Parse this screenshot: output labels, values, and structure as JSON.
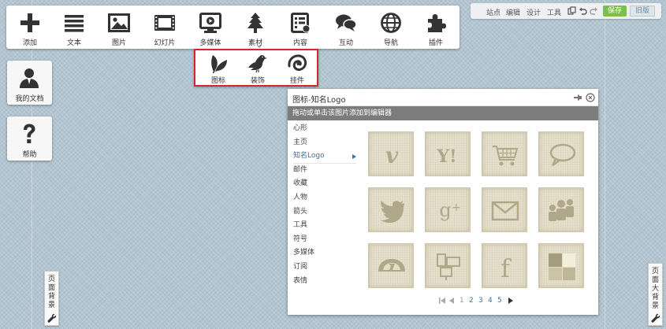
{
  "toolbar": {
    "items": [
      {
        "label": "添加",
        "icon": "plus-icon"
      },
      {
        "label": "文本",
        "icon": "text-lines-icon"
      },
      {
        "label": "图片",
        "icon": "picture-icon"
      },
      {
        "label": "幻灯片",
        "icon": "film-strip-icon"
      },
      {
        "label": "多媒体",
        "icon": "media-player-icon"
      },
      {
        "label": "素材",
        "icon": "tree-icon"
      },
      {
        "label": "内容",
        "icon": "content-list-icon"
      },
      {
        "label": "互动",
        "icon": "chat-bubbles-icon"
      },
      {
        "label": "导航",
        "icon": "globe-icon"
      },
      {
        "label": "插件",
        "icon": "puzzle-icon"
      }
    ]
  },
  "subtoolbar": {
    "items": [
      {
        "label": "图标",
        "icon": "leaf-icon"
      },
      {
        "label": "装饰",
        "icon": "bird-icon"
      },
      {
        "label": "挂件",
        "icon": "spiral-icon"
      }
    ]
  },
  "side": {
    "docs_label": "我的文档",
    "help_label": "帮助"
  },
  "tabs": {
    "left_label": "页面背景",
    "right_label": "页面大背景"
  },
  "topbar": {
    "links": [
      "站点",
      "编辑",
      "设计",
      "工具"
    ],
    "save_label": "保存",
    "old_label": "旧版"
  },
  "panel": {
    "title": "图标-知名Logo",
    "hint": "拖动或单击该图片添加到编辑器",
    "categories": [
      "心形",
      "主页",
      "知名Logo",
      "邮件",
      "收藏",
      "人物",
      "箭头",
      "工具",
      "符号",
      "多媒体",
      "订阅",
      "表情"
    ],
    "selected_category": "知名Logo",
    "logos": [
      "vimeo-icon",
      "yahoo-icon",
      "shopping-cart-icon",
      "speech-bubble-icon",
      "twitter-icon",
      "google-plus-icon",
      "mail-envelope-icon",
      "myspace-icon",
      "deviantart-icon",
      "delicious-puzzle-icon",
      "facebook-icon",
      "windows-blocks-icon"
    ],
    "pages": [
      "1",
      "2",
      "3",
      "4",
      "5"
    ],
    "current_page": "1"
  },
  "colors": {
    "accent_red": "#d9262c",
    "save_green": "#7cbf4a",
    "hint_bar": "#7c7c7c",
    "link_blue": "#3a6ea5",
    "tile_beige": "#e3dcc6",
    "icon_dark": "#333333",
    "logo_ink": "#b1a88b"
  }
}
